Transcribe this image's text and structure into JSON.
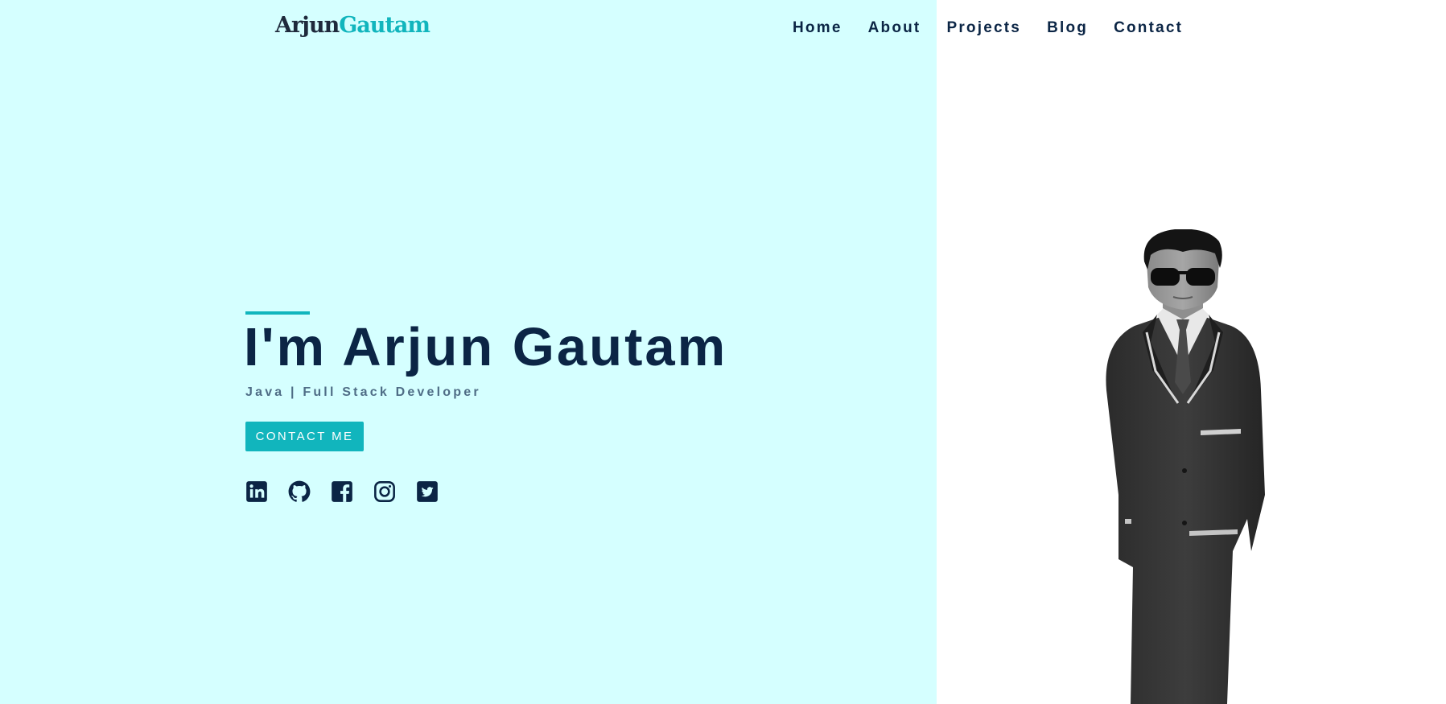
{
  "brand": {
    "first": "Arjun",
    "last": "Gautam"
  },
  "nav": [
    {
      "label": "Home"
    },
    {
      "label": "About"
    },
    {
      "label": "Projects"
    },
    {
      "label": "Blog"
    },
    {
      "label": "Contact"
    }
  ],
  "hero": {
    "title": "I'm Arjun Gautam",
    "subtitle": "Java | Full Stack Developer",
    "cta_label": "CONTACT ME"
  },
  "socials": [
    {
      "icon": "linkedin-icon"
    },
    {
      "icon": "github-icon"
    },
    {
      "icon": "facebook-icon"
    },
    {
      "icon": "instagram-icon"
    },
    {
      "icon": "twitter-icon"
    }
  ],
  "colors": {
    "left_panel_bg": "#d5ffff",
    "accent": "#11b5bd",
    "navy": "#0b2545",
    "subtitle": "#4f6d86"
  }
}
